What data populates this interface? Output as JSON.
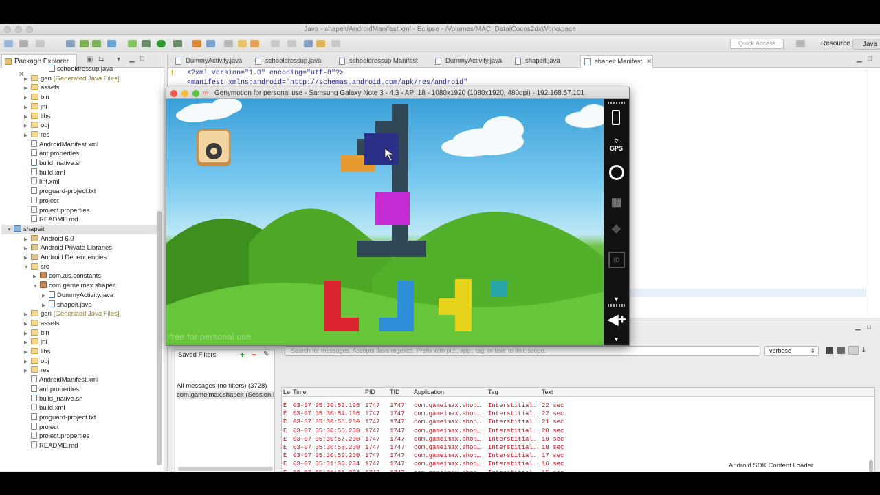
{
  "window_title": "Java - shapeit/AndroidManifest.xml - Eclipse - /Volumes/MAC_Data/Cocos2dxWorkspace",
  "quick_access_placeholder": "Quick Access",
  "perspectives": [
    "Resource",
    "Java"
  ],
  "package_explorer": {
    "tab_label": "Package Explorer",
    "rows": [
      {
        "indent": 3,
        "arrow": "",
        "icon": "java",
        "label": "schooldressup.java",
        "note": ""
      },
      {
        "indent": 1,
        "arrow": "▶",
        "icon": "folder",
        "label": "gen",
        "note": "[Generated Java Files]"
      },
      {
        "indent": 1,
        "arrow": "▶",
        "icon": "folder",
        "label": "assets",
        "note": ""
      },
      {
        "indent": 1,
        "arrow": "▶",
        "icon": "folder",
        "label": "bin",
        "note": ""
      },
      {
        "indent": 1,
        "arrow": "▶",
        "icon": "folder",
        "label": "jni",
        "note": ""
      },
      {
        "indent": 1,
        "arrow": "▶",
        "icon": "folder",
        "label": "libs",
        "note": ""
      },
      {
        "indent": 1,
        "arrow": "▶",
        "icon": "folder",
        "label": "obj",
        "note": ""
      },
      {
        "indent": 1,
        "arrow": "▶",
        "icon": "folder",
        "label": "res",
        "note": ""
      },
      {
        "indent": 1,
        "arrow": "",
        "icon": "file",
        "label": "AndroidManifest.xml",
        "note": ""
      },
      {
        "indent": 1,
        "arrow": "",
        "icon": "file",
        "label": "ant.properties",
        "note": ""
      },
      {
        "indent": 1,
        "arrow": "",
        "icon": "java",
        "label": "build_native.sh",
        "note": ""
      },
      {
        "indent": 1,
        "arrow": "",
        "icon": "file",
        "label": "build.xml",
        "note": ""
      },
      {
        "indent": 1,
        "arrow": "",
        "icon": "file",
        "label": "lint.xml",
        "note": ""
      },
      {
        "indent": 1,
        "arrow": "",
        "icon": "file",
        "label": "proguard-project.txt",
        "note": ""
      },
      {
        "indent": 1,
        "arrow": "",
        "icon": "file",
        "label": "project",
        "note": ""
      },
      {
        "indent": 1,
        "arrow": "",
        "icon": "file",
        "label": "project.properties",
        "note": ""
      },
      {
        "indent": 1,
        "arrow": "",
        "icon": "file",
        "label": "README.md",
        "note": ""
      },
      {
        "indent": 0,
        "arrow": "▼",
        "icon": "proj",
        "label": "shapeit",
        "note": ""
      },
      {
        "indent": 1,
        "arrow": "▶",
        "icon": "lib",
        "label": "Android 6.0",
        "note": ""
      },
      {
        "indent": 1,
        "arrow": "▶",
        "icon": "lib",
        "label": "Android Private Libraries",
        "note": ""
      },
      {
        "indent": 1,
        "arrow": "▶",
        "icon": "lib",
        "label": "Android Dependencies",
        "note": ""
      },
      {
        "indent": 1,
        "arrow": "▼",
        "icon": "folder",
        "label": "src",
        "note": ""
      },
      {
        "indent": 2,
        "arrow": "▶",
        "icon": "pkg",
        "label": "com.ais.constants",
        "note": ""
      },
      {
        "indent": 2,
        "arrow": "▼",
        "icon": "pkg",
        "label": "com.gameimax.shapeit",
        "note": ""
      },
      {
        "indent": 3,
        "arrow": "▶",
        "icon": "java",
        "label": "DummyActivity.java",
        "note": ""
      },
      {
        "indent": 3,
        "arrow": "▶",
        "icon": "java",
        "label": "shapeit.java",
        "note": ""
      },
      {
        "indent": 1,
        "arrow": "▶",
        "icon": "folder",
        "label": "gen",
        "note": "[Generated Java Files]"
      },
      {
        "indent": 1,
        "arrow": "▶",
        "icon": "folder",
        "label": "assets",
        "note": ""
      },
      {
        "indent": 1,
        "arrow": "▶",
        "icon": "folder",
        "label": "bin",
        "note": ""
      },
      {
        "indent": 1,
        "arrow": "▶",
        "icon": "folder",
        "label": "jni",
        "note": ""
      },
      {
        "indent": 1,
        "arrow": "▶",
        "icon": "folder",
        "label": "libs",
        "note": ""
      },
      {
        "indent": 1,
        "arrow": "▶",
        "icon": "folder",
        "label": "obj",
        "note": ""
      },
      {
        "indent": 1,
        "arrow": "▶",
        "icon": "folder",
        "label": "res",
        "note": ""
      },
      {
        "indent": 1,
        "arrow": "",
        "icon": "file",
        "label": "AndroidManifest.xml",
        "note": ""
      },
      {
        "indent": 1,
        "arrow": "",
        "icon": "file",
        "label": "ant.properties",
        "note": ""
      },
      {
        "indent": 1,
        "arrow": "",
        "icon": "java",
        "label": "build_native.sh",
        "note": ""
      },
      {
        "indent": 1,
        "arrow": "",
        "icon": "file",
        "label": "build.xml",
        "note": ""
      },
      {
        "indent": 1,
        "arrow": "",
        "icon": "file",
        "label": "proguard-project.txt",
        "note": ""
      },
      {
        "indent": 1,
        "arrow": "",
        "icon": "file",
        "label": "project",
        "note": ""
      },
      {
        "indent": 1,
        "arrow": "",
        "icon": "file",
        "label": "project.properties",
        "note": ""
      },
      {
        "indent": 1,
        "arrow": "",
        "icon": "file",
        "label": "README.md",
        "note": ""
      }
    ]
  },
  "editor": {
    "tabs": [
      "DummyActivity.java",
      "schooldressup.java",
      "schooldressup Manifest",
      "DummyActivity.java",
      "shapeit.java",
      "shapeit Manifest"
    ],
    "active_tab": 5,
    "line1": "<?xml version=\"1.0\" encoding=\"utf-8\"?>",
    "line2": "<manifest xmlns:android=\"http://schemas.android.com/apk/res/android\""
  },
  "genymotion": {
    "title": "Genymotion for personal use - Samsung Galaxy Note 3 - 4.3 - API 18 - 1080x1920 (1080x1920, 480dpi) - 192.168.57.101",
    "watermark": "free for personal use",
    "sidebar": {
      "gps_label": "GPS",
      "id_label": "ID"
    }
  },
  "logcat": {
    "search_placeholder": "Search for messages. Accepts Java regexes. Prefix with pid:, app:, tag: or text: to limit scope.",
    "level": "verbose",
    "saved_filters_title": "Saved Filters",
    "filters": [
      "All messages (no filters) (3728)",
      "com.gameimax.shapeit (Session F"
    ],
    "columns": [
      "Le",
      "Time",
      "PID",
      "TID",
      "Application",
      "Tag",
      "Text"
    ],
    "rows": [
      {
        "level": "E",
        "time": "03-07 05:30:53.196",
        "pid": "1747",
        "tid": "1747",
        "app": "com.gameimax.shop…",
        "tag": "Interstitial…",
        "text": "22 sec"
      },
      {
        "level": "E",
        "time": "03-07 05:30:54.196",
        "pid": "1747",
        "tid": "1747",
        "app": "com.gameimax.shop…",
        "tag": "Interstitial…",
        "text": "22 sec"
      },
      {
        "level": "E",
        "time": "03-07 05:30:55.200",
        "pid": "1747",
        "tid": "1747",
        "app": "com.gameimax.shop…",
        "tag": "Interstitial…",
        "text": "21 sec"
      },
      {
        "level": "E",
        "time": "03-07 05:30:56.200",
        "pid": "1747",
        "tid": "1747",
        "app": "com.gameimax.shop…",
        "tag": "Interstitial…",
        "text": "20 sec"
      },
      {
        "level": "E",
        "time": "03-07 05:30:57.200",
        "pid": "1747",
        "tid": "1747",
        "app": "com.gameimax.shop…",
        "tag": "Interstitial…",
        "text": "19 sec"
      },
      {
        "level": "E",
        "time": "03-07 05:30:58.200",
        "pid": "1747",
        "tid": "1747",
        "app": "com.gameimax.shop…",
        "tag": "Interstitial…",
        "text": "18 sec"
      },
      {
        "level": "E",
        "time": "03-07 05:30:59.200",
        "pid": "1747",
        "tid": "1747",
        "app": "com.gameimax.shop…",
        "tag": "Interstitial…",
        "text": "17 sec"
      },
      {
        "level": "E",
        "time": "03-07 05:31:00.204",
        "pid": "1747",
        "tid": "1747",
        "app": "com.gameimax.shop…",
        "tag": "Interstitial…",
        "text": "16 sec"
      },
      {
        "level": "E",
        "time": "03-07 05:31:01.204",
        "pid": "1747",
        "tid": "1747",
        "app": "com.gameimax.shop…",
        "tag": "Interstitial…",
        "text": "15 sec"
      }
    ]
  },
  "status_bar": {
    "text": "Android SDK Content Loader"
  },
  "colors": {
    "log_error": "#c0141b",
    "xml_text": "#1f1fa8",
    "game_sky": "#4fb3e6",
    "game_grass": "#4fae22"
  }
}
